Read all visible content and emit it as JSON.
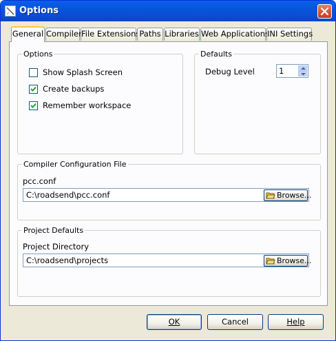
{
  "window": {
    "title": "Options"
  },
  "tabs": [
    {
      "label": "General",
      "active": true
    },
    {
      "label": "Compiler",
      "active": false
    },
    {
      "label": "File Extensions",
      "active": false
    },
    {
      "label": "Paths",
      "active": false
    },
    {
      "label": "Libraries",
      "active": false
    },
    {
      "label": "Web Applications",
      "active": false
    },
    {
      "label": "INI Settings",
      "active": false
    }
  ],
  "options_group": {
    "label": "Options",
    "items": [
      {
        "label": "Show Splash Screen",
        "checked": false
      },
      {
        "label": "Create backups",
        "checked": true
      },
      {
        "label": "Remember workspace",
        "checked": true
      }
    ]
  },
  "defaults_group": {
    "label": "Defaults",
    "debug_level_label": "Debug Level",
    "debug_level_value": "1"
  },
  "compiler_config": {
    "label": "Compiler Configuration File",
    "field_label": "pcc.conf",
    "path": "C:\\roadsend\\pcc.conf",
    "browse_label": "Browse..."
  },
  "project_defaults": {
    "label": "Project Defaults",
    "field_label": "Project Directory",
    "path": "C:\\roadsend\\projects",
    "browse_label": "Browse..."
  },
  "buttons": {
    "ok": "OK",
    "cancel": "Cancel",
    "help": "Help"
  },
  "colors": {
    "titlebar": "#0a5fe8",
    "dialog_bg": "#ece9d8",
    "active_tab_accent": "#ffc83c"
  }
}
